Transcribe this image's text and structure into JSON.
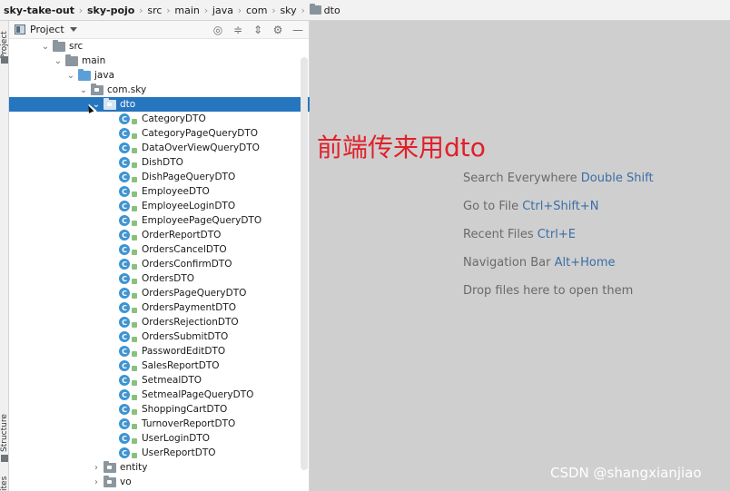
{
  "breadcrumbs": [
    {
      "label": "sky-take-out",
      "bold": true
    },
    {
      "label": "sky-pojo",
      "bold": true
    },
    {
      "label": "src"
    },
    {
      "label": "main"
    },
    {
      "label": "java"
    },
    {
      "label": "com"
    },
    {
      "label": "sky"
    },
    {
      "label": "dto",
      "folder": true
    }
  ],
  "side_strip": {
    "top_tab": "Project",
    "bottom_tab": "Structure",
    "bottom_cut": "ites"
  },
  "panel": {
    "title": "Project",
    "tools": [
      "target-icon",
      "expand-all-icon",
      "collapse-all-icon",
      "gear-icon",
      "hide-icon"
    ]
  },
  "tree": {
    "src": "src",
    "main": "main",
    "java": "java",
    "package": "com.sky",
    "selected_folder": "dto",
    "classes": [
      "CategoryDTO",
      "CategoryPageQueryDTO",
      "DataOverViewQueryDTO",
      "DishDTO",
      "DishPageQueryDTO",
      "EmployeeDTO",
      "EmployeeLoginDTO",
      "EmployeePageQueryDTO",
      "OrderReportDTO",
      "OrdersCancelDTO",
      "OrdersConfirmDTO",
      "OrdersDTO",
      "OrdersPageQueryDTO",
      "OrdersPaymentDTO",
      "OrdersRejectionDTO",
      "OrdersSubmitDTO",
      "PasswordEditDTO",
      "SalesReportDTO",
      "SetmealDTO",
      "SetmealPageQueryDTO",
      "ShoppingCartDTO",
      "TurnoverReportDTO",
      "UserLoginDTO",
      "UserReportDTO"
    ],
    "class_badge": "C",
    "entity": "entity",
    "vo": "vo"
  },
  "editor": {
    "annotation": "前端传来用dto",
    "hints": [
      {
        "text": "Search Everywhere ",
        "key": "Double Shift"
      },
      {
        "text": "Go to File ",
        "key": "Ctrl+Shift+N"
      },
      {
        "text": "Recent Files ",
        "key": "Ctrl+E"
      },
      {
        "text": "Navigation Bar ",
        "key": "Alt+Home"
      },
      {
        "text": "Drop files here to open them",
        "key": ""
      }
    ],
    "watermark": "CSDN @shangxianjiao"
  },
  "colors": {
    "selection": "#2675bf",
    "annotation": "#e0202a",
    "shortcut": "#3a6ea5",
    "editor_bg": "#cfcfcf"
  }
}
